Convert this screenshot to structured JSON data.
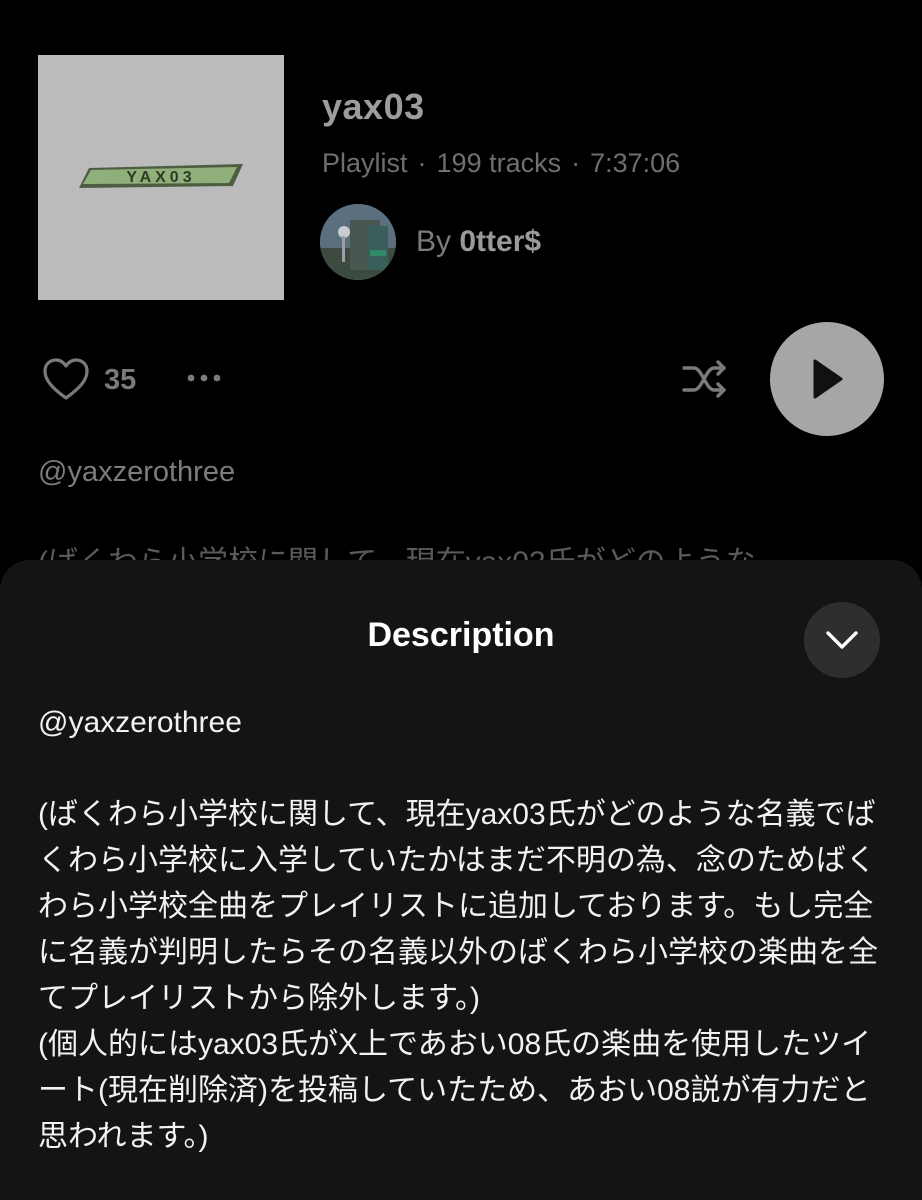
{
  "playlist": {
    "title": "yax03",
    "type": "Playlist",
    "tracks": "199 tracks",
    "duration": "7:37:06",
    "separator": "·",
    "by_prefix": "By",
    "owner": "0tter$",
    "likes": "35",
    "cover_logo": "YAX03",
    "handle": "@yaxzerothree",
    "description_preview": "(ばくわら小学校に関して、現在yax03氏がどのような"
  },
  "sheet": {
    "title": "Description",
    "handle": "@yaxzerothree",
    "paragraph1": "(ばくわら小学校に関して、現在yax03氏がどのような名義でばくわら小学校に入学していたかはまだ不明の為、念のためばくわら小学校全曲をプレイリストに追加しております。もし完全に名義が判明したらその名義以外のばくわら小学校の楽曲を全てプレイリストから除外します。)",
    "paragraph2": "(個人的にはyax03氏がX上であおい08氏の楽曲を使用したツイート(現在削除済)を投稿していたため、あおい08説が有力だと思われます。)"
  },
  "icons": {
    "like": "heart-icon",
    "more": "more-dots-icon",
    "shuffle": "shuffle-icon",
    "play": "play-icon",
    "collapse": "chevron-down-icon"
  },
  "colors": {
    "background": "#000000",
    "sheet": "#141414",
    "cover": "#bbbbbb",
    "logo_green": "#8fb07a"
  }
}
